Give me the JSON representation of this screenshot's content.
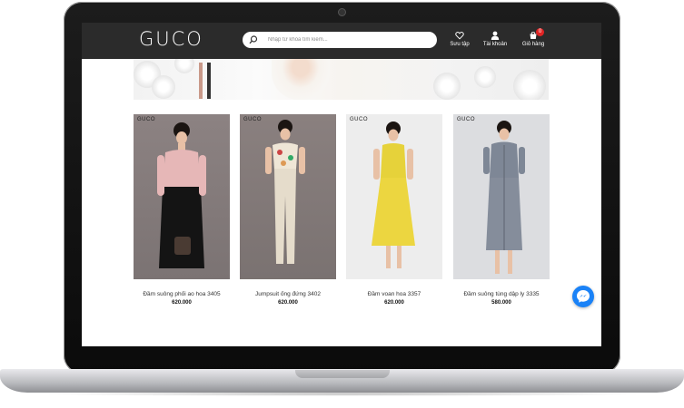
{
  "header": {
    "logo": "GUCO",
    "search_placeholder": "Nhập từ khóa tìm kiếm...",
    "collection_label": "Sưu tập",
    "account_label": "Tài khoản",
    "cart_label": "Giỏ hàng",
    "cart_count": "0"
  },
  "products": [
    {
      "brand": "GUCO",
      "name": "Đầm suông phối ao hoa 3405",
      "price": "620.000"
    },
    {
      "brand": "GUCO",
      "name": "Jumpsuit ống đứng 3402",
      "price": "620.000"
    },
    {
      "brand": "GUCO",
      "name": "Đầm voan hoa 3357",
      "price": "620.000"
    },
    {
      "brand": "GUCO",
      "name": "Đầm suông tùng dập ly 3335",
      "price": "580.000"
    }
  ],
  "colors": {
    "header_bg": "#2b2b2b",
    "cart_badge": "#e02424",
    "messenger": "#1a82f7"
  },
  "icons": [
    "search-icon",
    "heart-icon",
    "user-icon",
    "cart-icon",
    "messenger-icon"
  ]
}
